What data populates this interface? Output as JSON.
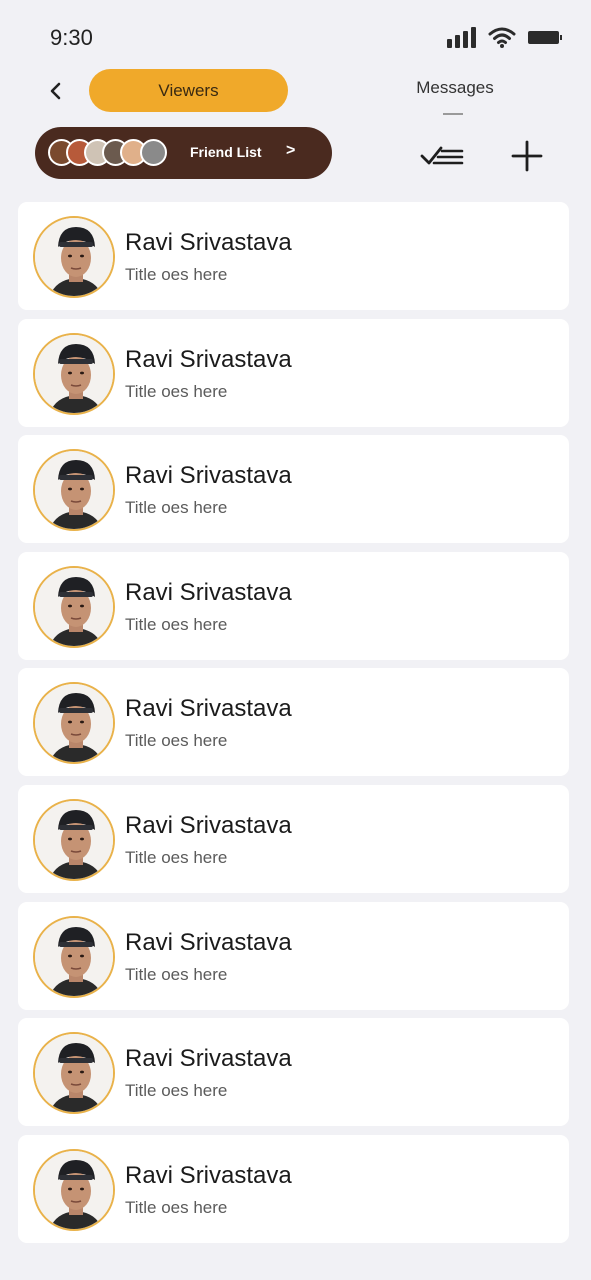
{
  "status_bar": {
    "time": "9:30"
  },
  "top_nav": {
    "back_label": "<",
    "tabs": [
      {
        "label": "Viewers",
        "active": true
      },
      {
        "label": "Messages",
        "active": false
      }
    ]
  },
  "friend_list": {
    "label": "Friend List",
    "chevron": ">",
    "avatar_count": 6
  },
  "colors": {
    "accent": "#f0a92a",
    "pill_bg": "#4a2a1f",
    "avatar_ring": "#e9b24a",
    "page_bg": "#f1f1f5"
  },
  "icons": [
    "signal-icon",
    "wifi-icon",
    "battery-icon",
    "back-icon",
    "check-list-icon",
    "plus-icon"
  ],
  "contacts": [
    {
      "name": "Ravi Srivastava",
      "title": "Title oes here"
    },
    {
      "name": "Ravi Srivastava",
      "title": "Title oes here"
    },
    {
      "name": "Ravi Srivastava",
      "title": "Title oes here"
    },
    {
      "name": "Ravi Srivastava",
      "title": "Title oes here"
    },
    {
      "name": "Ravi Srivastava",
      "title": "Title oes here"
    },
    {
      "name": "Ravi Srivastava",
      "title": "Title oes here"
    },
    {
      "name": "Ravi Srivastava",
      "title": "Title oes here"
    },
    {
      "name": "Ravi Srivastava",
      "title": "Title oes here"
    },
    {
      "name": "Ravi Srivastava",
      "title": "Title oes here"
    }
  ]
}
